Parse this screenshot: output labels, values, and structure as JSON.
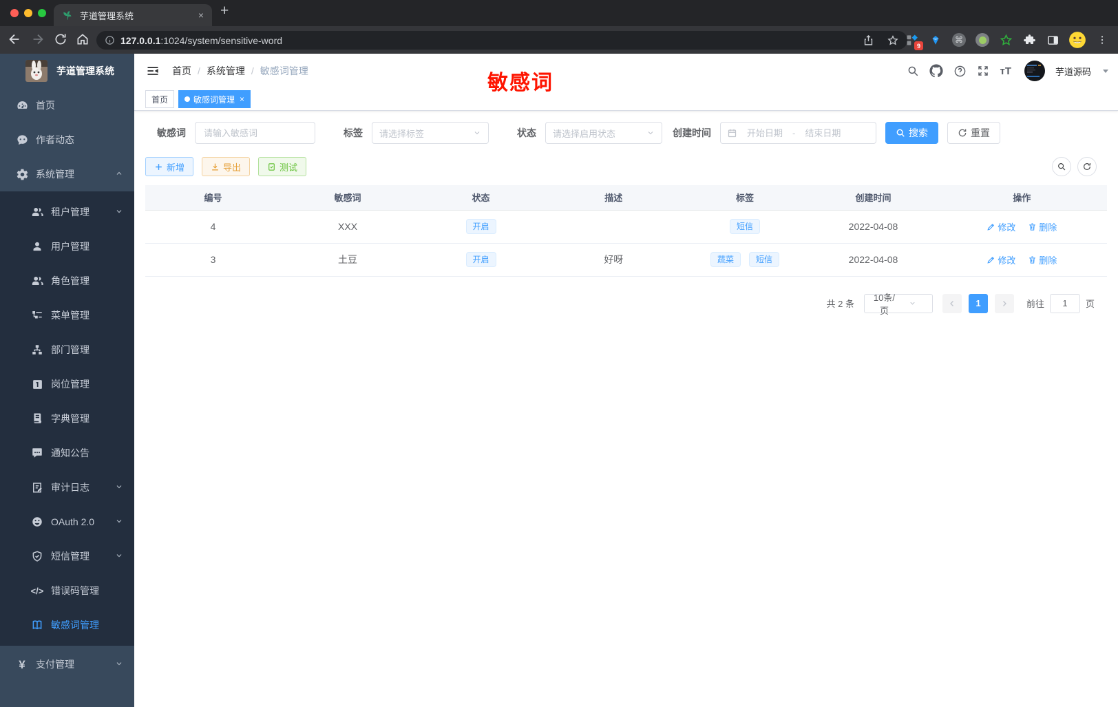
{
  "browser": {
    "tab_title": "芋道管理系统",
    "tab_close": "×",
    "new_tab": "+",
    "url_host": "127.0.0.1",
    "url_rest": ":1024/system/sensitive-word",
    "extension_badge": "9",
    "command_glyph": "⌘"
  },
  "sidebar": {
    "logo_title": "芋道管理系统",
    "items": [
      {
        "label": "首页"
      },
      {
        "label": "作者动态"
      },
      {
        "label": "系统管理"
      },
      {
        "label": "租户管理"
      },
      {
        "label": "用户管理"
      },
      {
        "label": "角色管理"
      },
      {
        "label": "菜单管理"
      },
      {
        "label": "部门管理"
      },
      {
        "label": "岗位管理"
      },
      {
        "label": "字典管理"
      },
      {
        "label": "通知公告"
      },
      {
        "label": "审计日志"
      },
      {
        "label": "OAuth 2.0"
      },
      {
        "label": "短信管理"
      },
      {
        "label": "错误码管理"
      },
      {
        "label": "敏感词管理"
      },
      {
        "label": "支付管理"
      }
    ],
    "active_item": "敏感词管理",
    "code_glyph": "</>",
    "pay_glyph": "¥"
  },
  "navbar": {
    "breadcrumb": [
      "首页",
      "系统管理",
      "敏感词管理"
    ],
    "separator": "/",
    "annotation": "敏感词",
    "username": "芋道源码",
    "font_size_glyph": "тT",
    "help_glyph": "?"
  },
  "tabbar": {
    "tab_home": "首页",
    "tab_active": "敏感词管理",
    "close": "×"
  },
  "filters": {
    "keyword_label": "敏感词",
    "keyword_placeholder": "请输入敏感词",
    "tag_label": "标签",
    "tag_placeholder": "请选择标签",
    "status_label": "状态",
    "status_placeholder": "请选择启用状态",
    "date_label": "创建时间",
    "date_start_placeholder": "开始日期",
    "date_separator": "-",
    "date_end_placeholder": "结束日期",
    "search_label": "搜索",
    "reset_label": "重置"
  },
  "toolbar": {
    "add_label": "新增",
    "export_label": "导出",
    "test_label": "测试"
  },
  "table": {
    "columns": [
      "编号",
      "敏感词",
      "状态",
      "描述",
      "标签",
      "创建时间",
      "操作"
    ],
    "rows": [
      {
        "id": "4",
        "word": "XXX",
        "status": "开启",
        "description": "",
        "tags": [
          "短信"
        ],
        "created": "2022-04-08",
        "edit": "修改",
        "delete": "删除"
      },
      {
        "id": "3",
        "word": "土豆",
        "status": "开启",
        "description": "好呀",
        "tags": [
          "蔬菜",
          "短信"
        ],
        "created": "2022-04-08",
        "edit": "修改",
        "delete": "删除"
      }
    ]
  },
  "pagination": {
    "total": "共 2 条",
    "page_size": "10条/页",
    "current_page": "1",
    "goto_label": "前往",
    "goto_value": "1",
    "page_unit": "页"
  },
  "colors": {
    "primary": "#409eff",
    "success": "#67c23a",
    "warning": "#e6a23c",
    "annotation_red": "#fe1400",
    "sidebar_bg": "#38495c",
    "submenu_bg": "#232e3e"
  }
}
